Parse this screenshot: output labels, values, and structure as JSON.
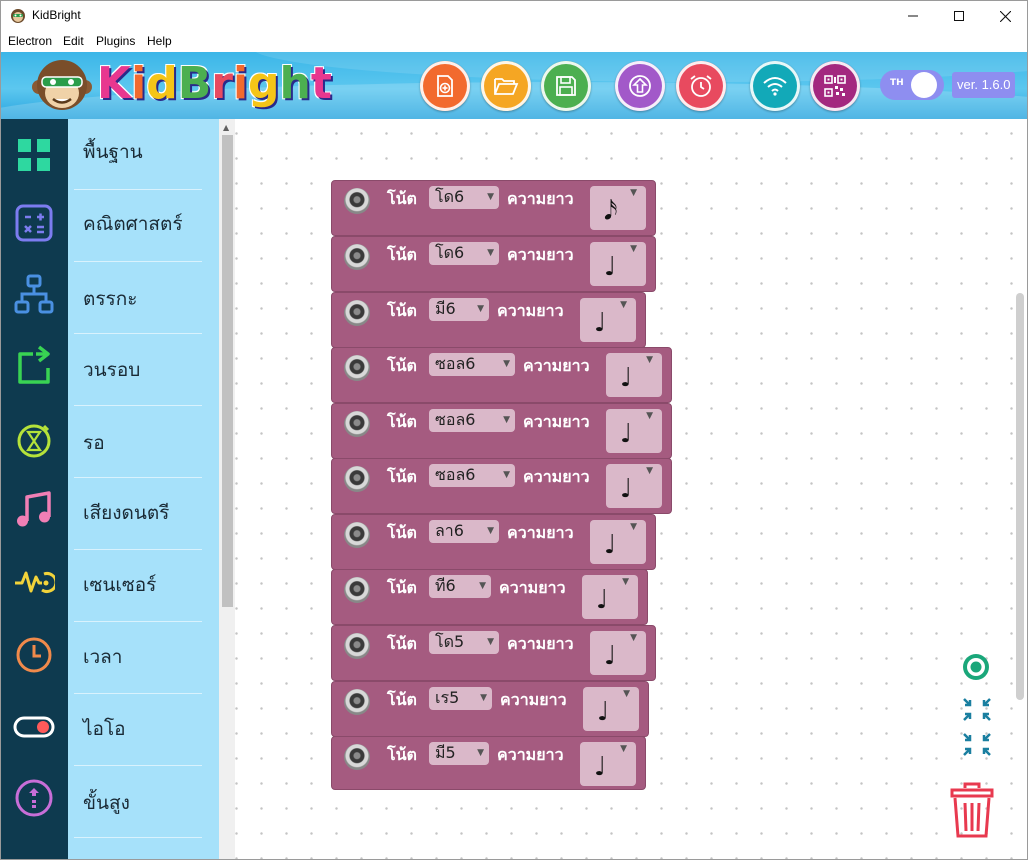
{
  "window": {
    "title": "KidBright",
    "minimize": "—",
    "maximize": "☐",
    "close": "✕"
  },
  "menu": [
    "Electron",
    "Edit",
    "Plugins",
    "Help"
  ],
  "header": {
    "logo": "KidBright",
    "language": "TH",
    "version": "ver. 1.6.0",
    "toolbar": [
      {
        "name": "new-file",
        "icon": "file-plus-icon",
        "color": "#f26a2e"
      },
      {
        "name": "open-file",
        "icon": "folder-open-icon",
        "color": "#f5a623"
      },
      {
        "name": "save-file",
        "icon": "floppy-disk-icon",
        "color": "#4caf50"
      },
      {
        "name": "upload",
        "icon": "upload-arrow-icon",
        "color": "#a259c9"
      },
      {
        "name": "alarm",
        "icon": "alarm-clock-icon",
        "color": "#e84a5f"
      },
      {
        "name": "wifi",
        "icon": "wifi-icon",
        "color": "#12a9b8"
      },
      {
        "name": "qr-code",
        "icon": "qr-code-icon",
        "color": "#a3287f"
      }
    ]
  },
  "sidebar": {
    "categories": [
      {
        "label": "พื้นฐาน",
        "icon": "grid-icon",
        "color": "#2ed8a0"
      },
      {
        "label": "คณิตศาสตร์",
        "icon": "calculator-icon",
        "color": "#7c7cf0"
      },
      {
        "label": "ตรรกะ",
        "icon": "hierarchy-icon",
        "color": "#4a90e2"
      },
      {
        "label": "วนรอบ",
        "icon": "loop-icon",
        "color": "#39d353"
      },
      {
        "label": "รอ",
        "icon": "timer-icon",
        "color": "#b5e23a"
      },
      {
        "label": "เสียงดนตรี",
        "icon": "music-note-icon",
        "color": "#f17fb5"
      },
      {
        "label": "เซนเซอร์",
        "icon": "sensor-icon",
        "color": "#f2d33a"
      },
      {
        "label": "เวลา",
        "icon": "clock-icon",
        "color": "#f08a4b"
      },
      {
        "label": "ไอโอ",
        "icon": "toggle-icon",
        "color": "#ff5a5a"
      },
      {
        "label": "ขั้นสูง",
        "icon": "advanced-icon",
        "color": "#c86ed8"
      }
    ]
  },
  "workspace": {
    "block_color": "#a55b80",
    "note_label": "โน้ต",
    "length_label": "ความยาว",
    "blocks": [
      {
        "note": "โด6",
        "duration": "𝅘𝅥𝅯",
        "duration_name": "sixteenth-note"
      },
      {
        "note": "โด6",
        "duration": "♩",
        "duration_name": "quarter-note"
      },
      {
        "note": "มี6",
        "duration": "♩",
        "duration_name": "quarter-note"
      },
      {
        "note": "ซอล6",
        "duration": "♩",
        "duration_name": "quarter-note"
      },
      {
        "note": "ซอล6",
        "duration": "♩",
        "duration_name": "quarter-note"
      },
      {
        "note": "ซอล6",
        "duration": "♩",
        "duration_name": "quarter-note"
      },
      {
        "note": "ลา6",
        "duration": "♩",
        "duration_name": "quarter-note"
      },
      {
        "note": "ที6",
        "duration": "♩",
        "duration_name": "quarter-note"
      },
      {
        "note": "โด5",
        "duration": "♩",
        "duration_name": "quarter-note"
      },
      {
        "note": "เร5",
        "duration": "♩",
        "duration_name": "quarter-note"
      },
      {
        "note": "มี5",
        "duration": "♩",
        "duration_name": "quarter-note"
      }
    ]
  }
}
